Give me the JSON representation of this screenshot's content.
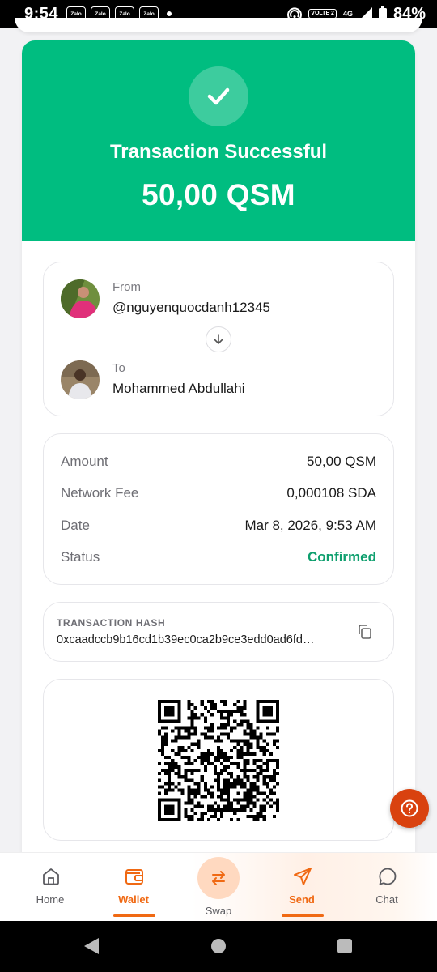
{
  "status_bar": {
    "time": "9:54",
    "apps": [
      "Zalo",
      "Zalo",
      "Zalo",
      "Zalo"
    ],
    "network_badge": "VOLTE 2",
    "network_type": "4G",
    "battery": "84%"
  },
  "transaction": {
    "title": "Transaction Successful",
    "amount": "50,00 QSM",
    "accent_color": "#00bd80"
  },
  "parties": {
    "from_label": "From",
    "from_name": "@nguyenquocdanh12345",
    "to_label": "To",
    "to_name": "Mohammed Abdullahi"
  },
  "details": {
    "amount_label": "Amount",
    "amount_value": "50,00 QSM",
    "fee_label": "Network Fee",
    "fee_value": "0,000108 SDA",
    "date_label": "Date",
    "date_value": "Mar 8, 2026, 9:53 AM",
    "status_label": "Status",
    "status_value": "Confirmed"
  },
  "hash": {
    "label": "TRANSACTION HASH",
    "value": "0xcaadccb9b16cd1b39ec0ca2b9ce3edd0ad6fd…"
  },
  "nav": {
    "home": "Home",
    "wallet": "Wallet",
    "swap": "Swap",
    "send": "Send",
    "chat": "Chat",
    "active_color": "#f06913"
  }
}
